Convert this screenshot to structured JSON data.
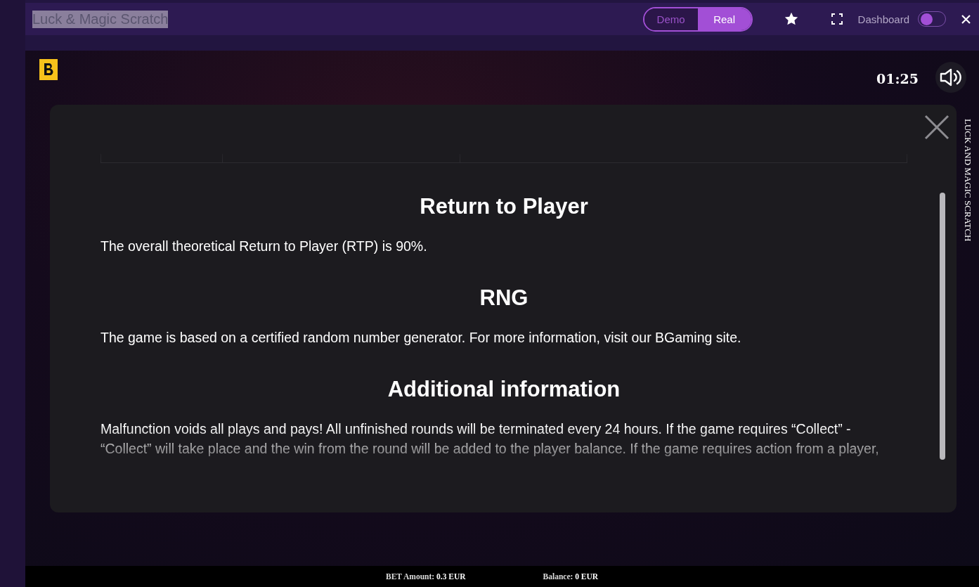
{
  "header": {
    "title": "Luck & Magic Scratch",
    "modes": [
      {
        "label": "Demo",
        "selected": false
      },
      {
        "label": "Real",
        "selected": true
      }
    ],
    "dashboard": {
      "label": "Dashboard",
      "on": false
    }
  },
  "game": {
    "timer": "01:25",
    "side_title": "LUCK AND MAGIC SCRATCH"
  },
  "modal": {
    "sections": [
      {
        "heading": "Return to Player",
        "text": "The overall theoretical Return to Player (RTP) is 90%."
      },
      {
        "heading": "RNG",
        "text": "The game is based on a certified random number generator. For more information, visit our BGaming site."
      },
      {
        "heading": "Additional information",
        "text": "Malfunction voids all plays and pays! All unfinished rounds will be terminated every 24 hours. If the game requires “Collect” - “Collect” will take place and the win from the round will be added to the player balance. If the game requires action from a player,"
      }
    ]
  },
  "status_bar": [
    {
      "label": "BET Amount:",
      "value": "0.3 EUR"
    },
    {
      "label": "Balance:",
      "value": "0 EUR"
    }
  ]
}
